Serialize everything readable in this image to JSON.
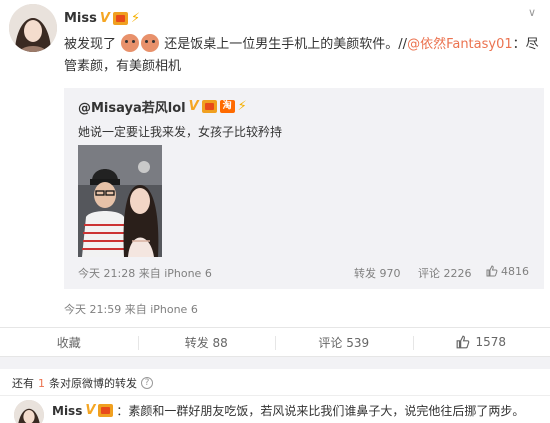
{
  "post": {
    "author": "Miss",
    "text_part1": "被发现了",
    "text_part2": "还是饭桌上一位男生手机上的美颜软件。//",
    "mention": "@依然Fantasy01",
    "text_part3": "：尽管素颜，有美颜相机",
    "time": "今天 21:59 来自 iPhone 6",
    "collapse_icon": "chevron-down"
  },
  "repost": {
    "author": "@Misaya若风lol",
    "text": "她说一定要让我来发，女孩子比较矜持",
    "time": "今天 21:28 来自 iPhone 6",
    "repost_count": "转发 970",
    "comment_count": "评论 2226",
    "like_count": "4816"
  },
  "actions": {
    "favorite": "收藏",
    "repost": "转发 88",
    "comment": "评论 539",
    "like": "1578"
  },
  "more": {
    "prefix": "还有",
    "count": "1",
    "suffix": "条对原微博的转发"
  },
  "reply": {
    "author": "Miss",
    "text": "：素颜和一群好朋友吃饭，若风说来比我们谁鼻子大，说完他往后挪了两步。"
  },
  "colors": {
    "accent": "#eb7350",
    "badge_gold": "#f5a623",
    "repost_bg": "#f2f2f5"
  }
}
